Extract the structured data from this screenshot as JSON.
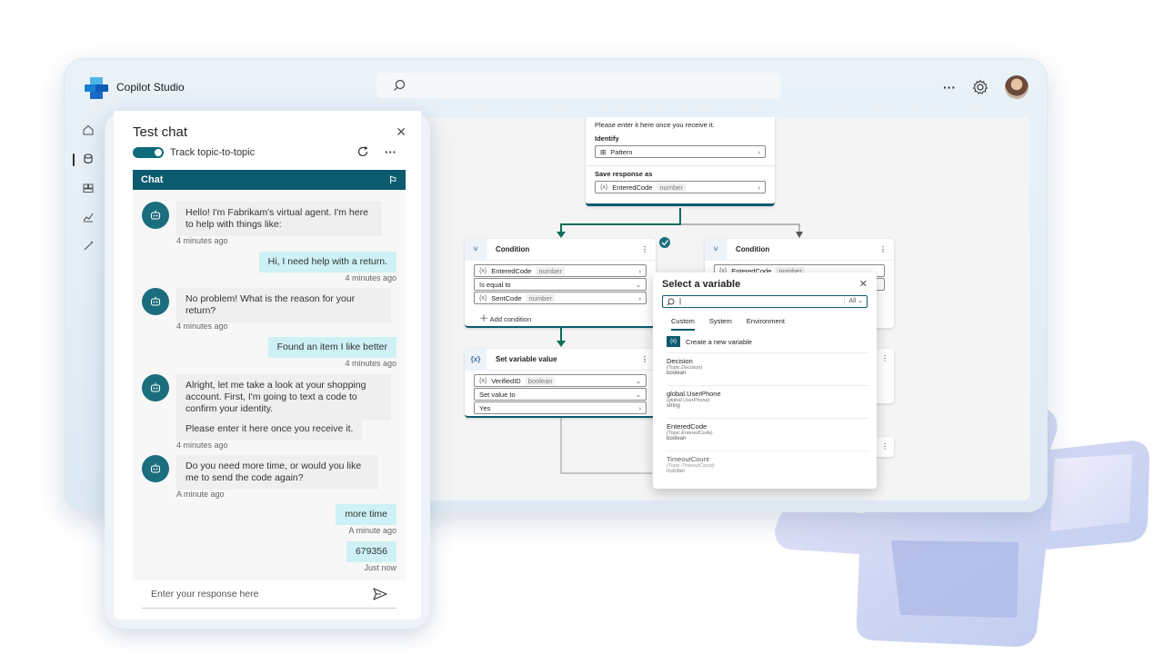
{
  "app": {
    "title": "Copilot Studio"
  },
  "topbar": {
    "more_label": "···"
  },
  "sidebar": {
    "items": [
      "home-icon",
      "agents-icon",
      "library-icon",
      "analytics-icon",
      "tools-icon"
    ]
  },
  "canvas": {
    "top_node": {
      "text": "Please enter it here once you receive it.",
      "identify_label": "Identify",
      "identify_value": "Pattern",
      "save_label": "Save response as",
      "save_var": "EnteredCode",
      "save_type": "number"
    },
    "condition_left": {
      "title": "Condition",
      "var": "EnteredCode",
      "var_type": "number",
      "operator": "Is equal to",
      "value": "SentCode",
      "value_type": "number",
      "add": "Add condition"
    },
    "condition_right": {
      "title": "Condition",
      "var": "EnteredCode",
      "var_type": "number"
    },
    "set_var": {
      "title": "Set variable value",
      "var": "VerifiedID",
      "var_type": "boolean",
      "set_label": "Set value to",
      "value": "Yes"
    },
    "token": "{x}"
  },
  "select_variable": {
    "title": "Select a variable",
    "search_value": "|",
    "filter": "All",
    "tabs": [
      "Custom",
      "System",
      "Environment"
    ],
    "create": "Create a new variable",
    "items": [
      {
        "name": "Decision",
        "scope": "(Topic.Decision)",
        "type": "boolean"
      },
      {
        "name": "global.UserPhone",
        "scope": "(global.UserPhone)",
        "type": "string"
      },
      {
        "name": "EnteredCode",
        "scope": "(Topic.EnteredCode)",
        "type": "boolean"
      },
      {
        "name": "TimeoutCount",
        "scope": "(Topic.TimeoutCount)",
        "type": "number"
      }
    ]
  },
  "test_chat": {
    "title": "Test chat",
    "toggle_label": "Track topic-to-topic",
    "chat_header": "Chat",
    "messages": [
      {
        "text": "Hello! I'm Fabrikam's virtual agent. I'm here to help with things like:",
        "time": "4 minutes ago"
      },
      {
        "text": "Hi, I need help with a return.",
        "time": "4 minutes ago"
      },
      {
        "text": "No problem! What is the reason for your return?",
        "time": "4 minutes ago"
      },
      {
        "text": "Found an item I like better",
        "time": "4 minutes ago"
      },
      {
        "text": "Alright, let me take a look at your shopping account. First, I'm going to text a code to confirm your identity.",
        "text2": "Please enter it here once you receive it.",
        "time": "4 minutes ago"
      },
      {
        "text": "Do you need more time, or would you like me to send the code again?",
        "time": "A minute ago"
      },
      {
        "text": "more time",
        "time": "A minute ago"
      },
      {
        "text": "679356",
        "time": "Just now"
      }
    ],
    "composer_placeholder": "Enter your response here"
  }
}
